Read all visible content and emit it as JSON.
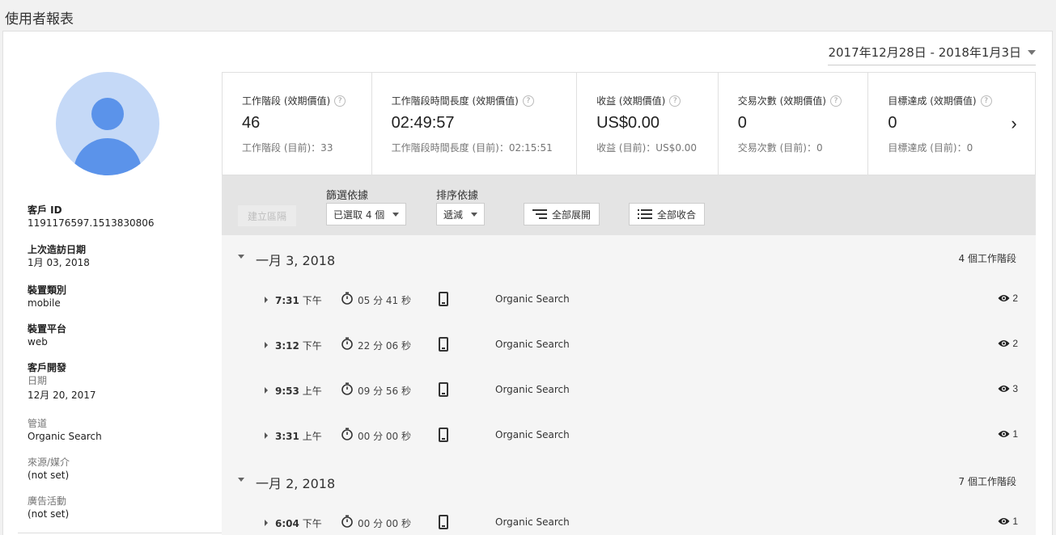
{
  "page_title": "使用者報表",
  "date_range": "2017年12月28日 - 2018年1月3日",
  "sidebar": {
    "client_id_label": "客戶 ID",
    "client_id": "1191176597.1513830806",
    "last_visit_label": "上次造訪日期",
    "last_visit": "1月 03, 2018",
    "device_category_label": "裝置類別",
    "device_category": "mobile",
    "device_platform_label": "裝置平台",
    "device_platform": "web",
    "acquisition_label": "客戶開發",
    "acq_date_label": "日期",
    "acq_date": "12月 20, 2017",
    "channel_label": "管道",
    "channel": "Organic Search",
    "source_label": "來源/媒介",
    "source": "(not set)",
    "campaign_label": "廣告活動",
    "campaign": "(not set)"
  },
  "metrics": [
    {
      "title": "工作階段 (效期價值)",
      "value": "46",
      "sub": "工作階段 (目前)：33"
    },
    {
      "title": "工作階段時間長度 (效期價值)",
      "value": "02:49:57",
      "sub": "工作階段時間長度 (目前)：02:15:51"
    },
    {
      "title": "收益 (效期價值)",
      "value": "US$0.00",
      "sub": "收益 (目前)：US$0.00"
    },
    {
      "title": "交易次數 (效期價值)",
      "value": "0",
      "sub": "交易次數 (目前)：0"
    },
    {
      "title": "目標達成 (效期價值)",
      "value": "0",
      "sub": "目標達成 (目前)：0"
    }
  ],
  "metrics_next": "›",
  "toolbar": {
    "create_segment": "建立區隔",
    "filter_label": "篩選依據",
    "filter_value": "已選取 4 個",
    "sort_label": "排序依據",
    "sort_value": "遞減",
    "expand_all": "全部展開",
    "collapse_all": "全部收合"
  },
  "groups": [
    {
      "date": "一月 3, 2018",
      "count": "4 個工作階段",
      "sessions": [
        {
          "time": "7:31",
          "ampm": "下午",
          "duration": "05 分 41 秒",
          "channel": "Organic Search",
          "views": "2"
        },
        {
          "time": "3:12",
          "ampm": "下午",
          "duration": "22 分 06 秒",
          "channel": "Organic Search",
          "views": "2"
        },
        {
          "time": "9:53",
          "ampm": "上午",
          "duration": "09 分 56 秒",
          "channel": "Organic Search",
          "views": "3"
        },
        {
          "time": "3:31",
          "ampm": "上午",
          "duration": "00 分 00 秒",
          "channel": "Organic Search",
          "views": "1"
        }
      ]
    },
    {
      "date": "一月 2, 2018",
      "count": "7 個工作階段",
      "sessions": [
        {
          "time": "6:04",
          "ampm": "下午",
          "duration": "00 分 00 秒",
          "channel": "Organic Search",
          "views": "1"
        }
      ]
    }
  ],
  "colors": {
    "accent": "#5b93ea",
    "avatar_bg": "#c5d9f7",
    "toolbar_bg": "#e4e4e4"
  }
}
